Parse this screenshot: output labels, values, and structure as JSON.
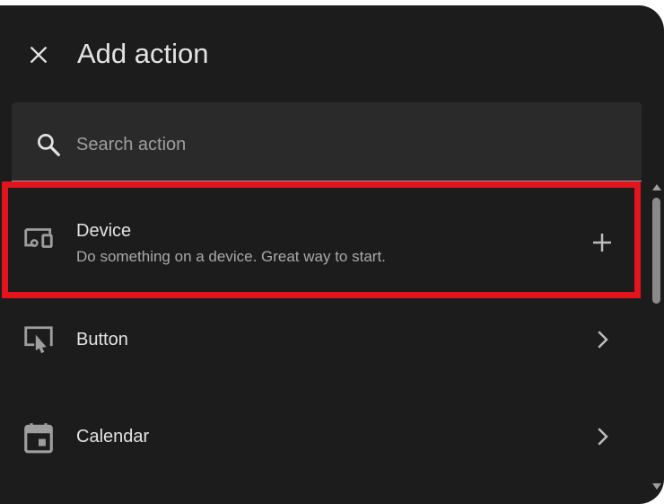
{
  "dialog": {
    "title": "Add action",
    "close_icon": "close-icon"
  },
  "search": {
    "placeholder": "Search action",
    "value": "",
    "icon": "search-icon"
  },
  "items": [
    {
      "label": "Device",
      "description": "Do something on a device. Great way to start.",
      "icon": "devices-icon",
      "trailing_icon": "plus-icon",
      "highlighted": true
    },
    {
      "label": "Button",
      "icon": "gesture-tap-button-icon",
      "trailing_icon": "chevron-right-icon"
    },
    {
      "label": "Calendar",
      "icon": "calendar-icon",
      "trailing_icon": "chevron-right-icon"
    }
  ],
  "colors": {
    "background": "#1c1c1c",
    "search_background": "#2a2a2a",
    "text_primary": "#e3e3e3",
    "text_secondary": "#a9a9a9",
    "highlight": "#e3141b"
  }
}
